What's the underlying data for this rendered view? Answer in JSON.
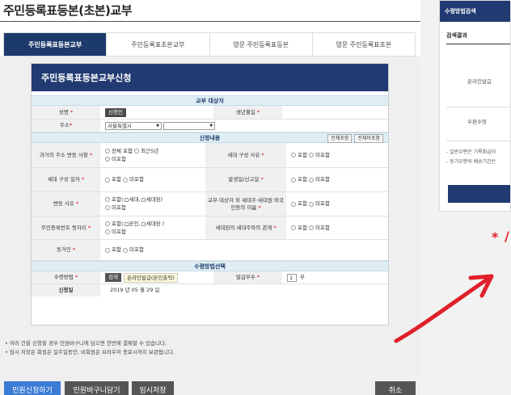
{
  "page_title": "주민등록표등본(초본)교부",
  "tabs": [
    {
      "label": "주민등록표등본교부",
      "active": true
    },
    {
      "label": "주민등록표초본교부",
      "active": false
    },
    {
      "label": "영문 주민등록표등본",
      "active": false
    },
    {
      "label": "영문 주민등록표초본",
      "active": false
    }
  ],
  "form": {
    "title": "주민등록표등본교부신청",
    "section_target": "교부 대상자",
    "name_label": "성명",
    "name_value": "신청인",
    "birth_label": "생년월일",
    "address_label": "주소",
    "address_city": "서울특별시",
    "address_district": "",
    "section_content": "신청내용",
    "include_all_btn": "전체포함",
    "exclude_all_btn": "전체미포함",
    "past_address_label": "과거의 주소 변동 사항",
    "past_address_opt1": "전체 포함",
    "past_address_opt2": "최근5년",
    "past_address_opt3": "미포함",
    "household_reason_label": "세대 구성 사유",
    "household_date_label": "세대 구성 일자",
    "report_date_label": "발생일/신고일",
    "change_reason_label": "변동 사유",
    "change_reason_opt1a": "포함(",
    "change_reason_opt1b": "세대,",
    "change_reason_opt1c": "세대원)",
    "relation_label": "교부 대상자 외 세대주·세대원·외국인등의 이름",
    "rrn_label": "주민등록번호 뒷자리",
    "rrn_opt1a": "포함(",
    "rrn_opt1b": "본인,",
    "rrn_opt1c": "세대원 )",
    "householder_relation_label": "세대원의 세대주와의 관계",
    "cohabitant_label": "동거인",
    "include": "포함",
    "exclude": "미포함",
    "section_receive": "수령방법선택",
    "receive_label": "수령방법",
    "search_btn": "검색",
    "receive_value": "온라인발급(본인출력)",
    "copies_label": "발급부수",
    "copies_value": "1",
    "copies_unit": "부",
    "apply_date_label": "신청일",
    "apply_date_value": "2019 년 05 월 29 일"
  },
  "notes": [
    "• 여러 건을 신청할 경우 민원바구니에 담으면 한번에 결제할 수 있습니다.",
    "• 임시 저장은 회원은 일주일동안, 비회원은 브라우저 종료시까지 보관됩니다."
  ],
  "buttons": {
    "apply": "민원신청하기",
    "cart": "민원바구니담기",
    "temp_save": "임시저장",
    "cancel": "취소"
  },
  "sidebar": {
    "header": "수령방법검색",
    "subheader": "검색결과",
    "row1": "온라인발급",
    "row2": "우편수령",
    "note1": "- 일반우편은 기록취급이",
    "note2": "- 등기우편의 배송기간은"
  },
  "colors": {
    "primary_navy": "#213b72",
    "apply_blue": "#3a7bd5",
    "annotation_red": "#e0202a"
  }
}
